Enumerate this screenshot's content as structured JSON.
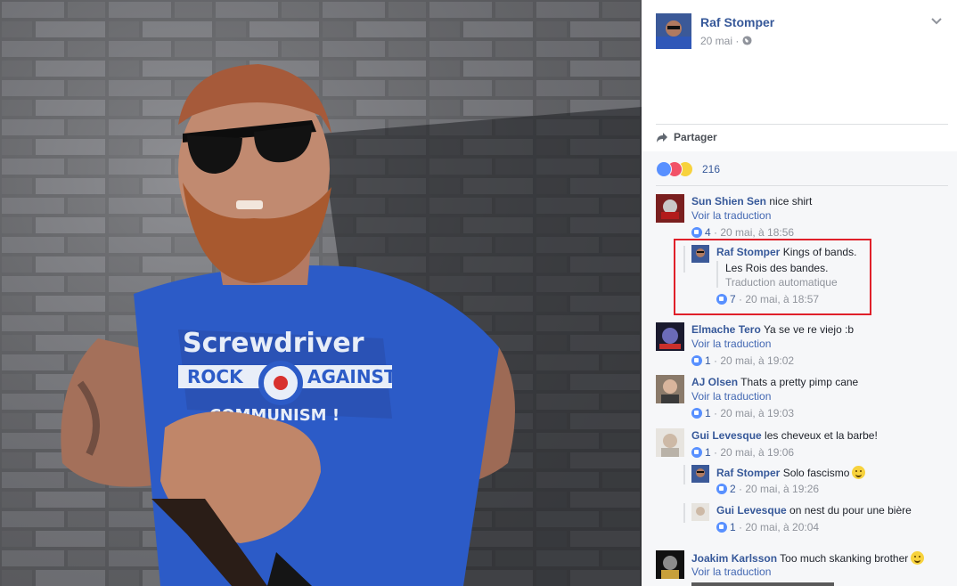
{
  "post": {
    "author": "Raf Stomper",
    "date": "20 mai",
    "separator": "·",
    "privacy_icon": "globe-icon",
    "options_icon": "chevron-down-icon",
    "share_label": "Partager",
    "reaction_count": "216",
    "reaction_icons": [
      "like-icon",
      "love-icon",
      "haha-icon"
    ]
  },
  "photo": {
    "shirt_text": [
      "Screwdriver",
      "ROCK",
      "AGAINST",
      "COMMUNISM !"
    ]
  },
  "comments": [
    {
      "name": "Sun Shien Sen",
      "text": "nice shirt",
      "translate": "Voir la traduction",
      "likes": "4",
      "time": "· 20 mai, à 18:56"
    },
    {
      "name": "Raf Stomper",
      "text": "Kings of bands.",
      "translation": "Les Rois des bandes.",
      "auto": "Traduction automatique",
      "likes": "7",
      "time": "· 20 mai, à 18:57"
    },
    {
      "name": "Elmache Tero",
      "text": "Ya se ve re viejo :b",
      "translate": "Voir la traduction",
      "likes": "1",
      "time": "· 20 mai, à 19:02"
    },
    {
      "name": "AJ Olsen",
      "text": "Thats a pretty pimp cane",
      "translate": "Voir la traduction",
      "likes": "1",
      "time": "· 20 mai, à 19:03"
    },
    {
      "name": "Gui Levesque",
      "text": "les cheveux et la barbe!",
      "likes": "1",
      "time": "· 20 mai, à 19:06"
    },
    {
      "name": "Raf Stomper",
      "text": "Solo fascismo",
      "likes": "2",
      "time": "· 20 mai, à 19:26"
    },
    {
      "name": "Gui Levesque",
      "text": "on nest du pour une bière",
      "likes": "1",
      "time": "· 20 mai, à 20:04"
    },
    {
      "name": "Joakim Karlsson",
      "text": "Too much skanking brother",
      "translate": "Voir la traduction"
    }
  ],
  "colors": {
    "link": "#365899",
    "accent": "#4267b2",
    "meta": "#90949c",
    "highlight": "#e0202a",
    "panel_bg": "#f6f7f9"
  }
}
